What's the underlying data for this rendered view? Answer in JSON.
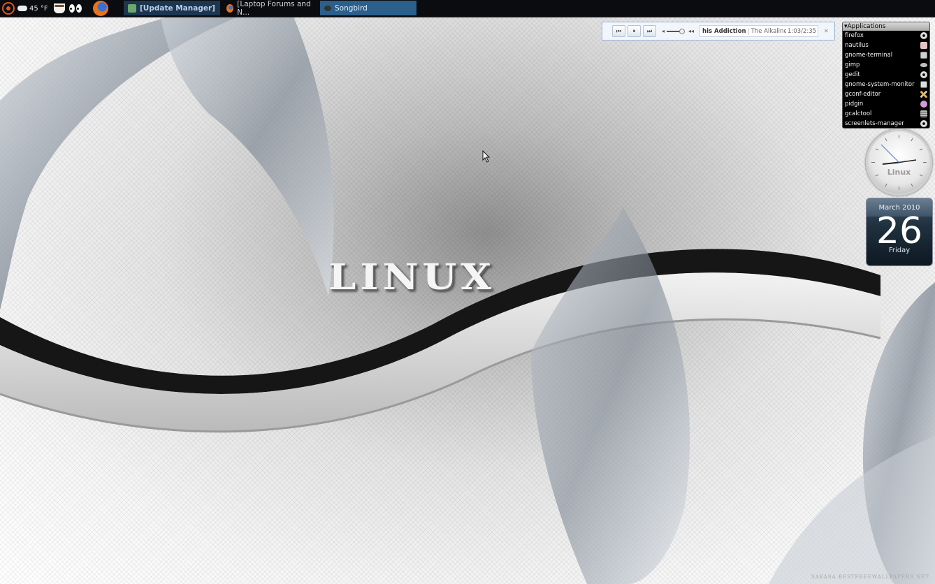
{
  "top_panel": {
    "temperature": "45 °F",
    "tasks": [
      {
        "label": "[Update Manager]"
      },
      {
        "label": "[Laptop Forums and N..."
      },
      {
        "label": "Songbird"
      }
    ]
  },
  "mini_player": {
    "prev": "⏮",
    "pause": "⏸",
    "next": "⏭",
    "vol_low": "◂",
    "vol_high": "◂◂",
    "track_title": "his Addiction",
    "track_artist": "The Alkaline Tr",
    "track_time": "1:03/2:35",
    "close": "✕"
  },
  "applications": {
    "header": "▾Applications",
    "items": [
      {
        "label": "firefox",
        "icon": "gear-icon"
      },
      {
        "label": "nautilus",
        "icon": "nautilus-icon"
      },
      {
        "label": "gnome-terminal",
        "icon": "terminal-icon"
      },
      {
        "label": "gimp",
        "icon": "gimp-icon"
      },
      {
        "label": "gedit",
        "icon": "gear-icon"
      },
      {
        "label": "gnome-system-monitor",
        "icon": "monitor-icon"
      },
      {
        "label": "gconf-editor",
        "icon": "tools-icon"
      },
      {
        "label": "pidgin",
        "icon": "pidgin-icon"
      },
      {
        "label": "gcalctool",
        "icon": "calculator-icon"
      },
      {
        "label": "screenlets-manager",
        "icon": "gear-icon"
      }
    ]
  },
  "clock": {
    "label": "Linux"
  },
  "calendar": {
    "month": "March 2010",
    "day": "26",
    "weekday": "Friday"
  },
  "wallpaper": {
    "logo": "LINUX",
    "watermark": "SAKASA BESTFREEWALLPAPERS.NET"
  }
}
